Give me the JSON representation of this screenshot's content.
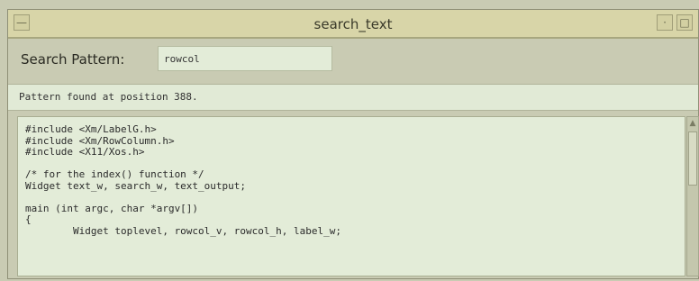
{
  "window": {
    "title": "search_text",
    "menu_glyph": "—",
    "minimize_glyph": "·",
    "maximize_glyph": "□"
  },
  "search": {
    "label": "Search Pattern:",
    "value": "rowcol"
  },
  "status": {
    "message": "Pattern found at position 388."
  },
  "text_output": {
    "lines": [
      "#include <Xm/LabelG.h>",
      "#include <Xm/RowColumn.h>",
      "#include <X11/Xos.h>",
      "",
      "/* for the index() function */",
      "Widget text_w, search_w, text_output;",
      "",
      "main (int argc, char *argv[])",
      "{",
      "        Widget toplevel, rowcol_v, rowcol_h, label_w;"
    ]
  },
  "scrollbar": {
    "up_arrow_glyph": "▲"
  },
  "colors": {
    "window_bg": "#c9cbb3",
    "titlebar_bg": "#d8d5a8",
    "text_bg": "#e3ecd8"
  }
}
